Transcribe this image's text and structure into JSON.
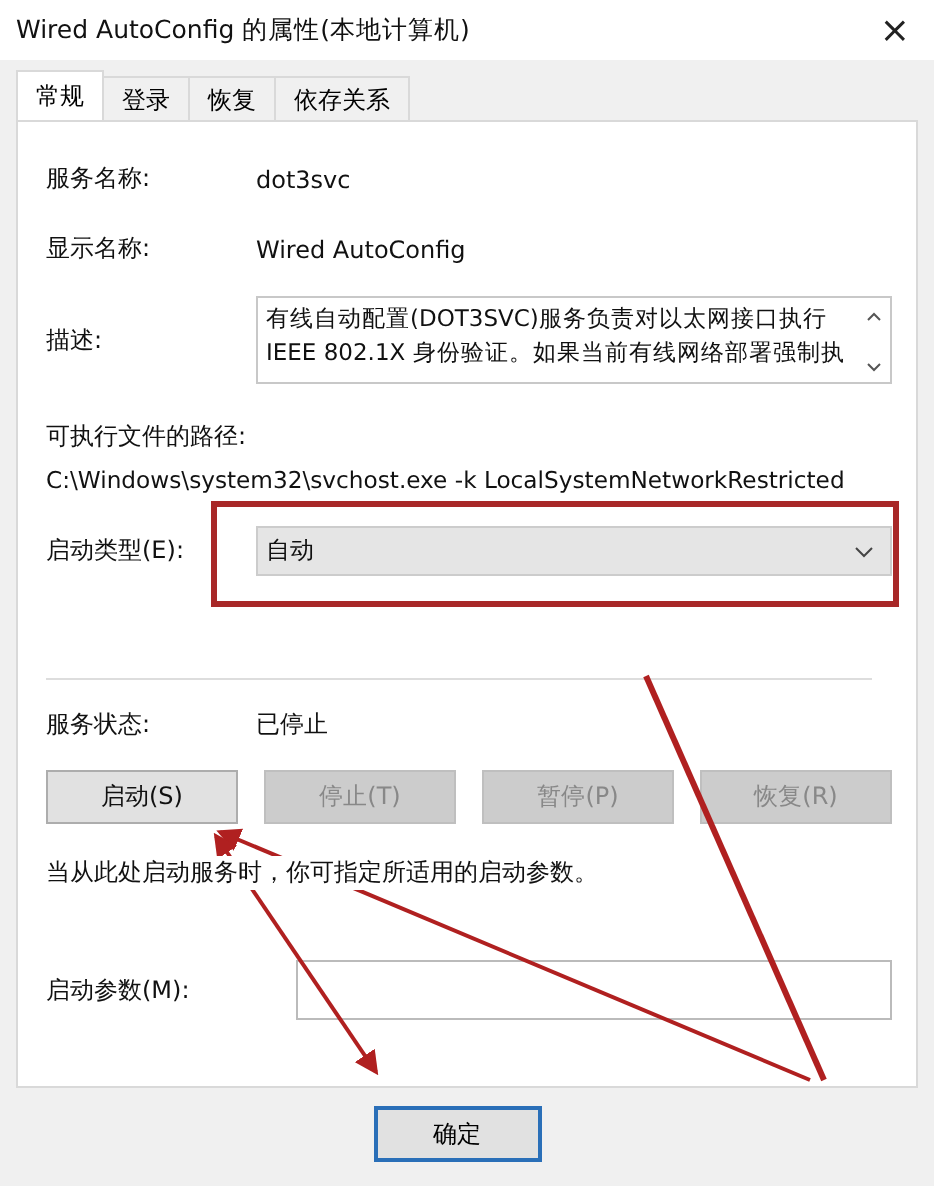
{
  "window": {
    "title": "Wired AutoConfig 的属性(本地计算机)",
    "close": "×"
  },
  "tabs": [
    {
      "label": "常规",
      "selected": true
    },
    {
      "label": "登录",
      "selected": false
    },
    {
      "label": "恢复",
      "selected": false
    },
    {
      "label": "依存关系",
      "selected": false
    }
  ],
  "general": {
    "service_name": {
      "label": "服务名称:",
      "value": "dot3svc"
    },
    "display_name": {
      "label": "显示名称:",
      "value": "Wired AutoConfig"
    },
    "description": {
      "label": "描述:",
      "value": "有线自动配置(DOT3SVC)服务负责对以太网接口执行 IEEE 802.1X 身份验证。如果当前有线网络部署强制执"
    },
    "path": {
      "label": "可执行文件的路径:",
      "value": "C:\\Windows\\system32\\svchost.exe -k LocalSystemNetworkRestricted"
    },
    "startup_type": {
      "label": "启动类型(E):",
      "value": "自动"
    },
    "service_status": {
      "label": "服务状态:",
      "value": "已停止"
    },
    "service_buttons": [
      {
        "label": "启动(S)",
        "disabled": false
      },
      {
        "label": "停止(T)",
        "disabled": true
      },
      {
        "label": "暂停(P)",
        "disabled": true
      },
      {
        "label": "恢复(R)",
        "disabled": true
      }
    ],
    "hint": "当从此处启动服务时，你可指定所适用的启动参数。",
    "start_parameters": {
      "label": "启动参数(M):"
    }
  },
  "dialog_buttons": [
    {
      "label": "确定",
      "default": true
    }
  ]
}
